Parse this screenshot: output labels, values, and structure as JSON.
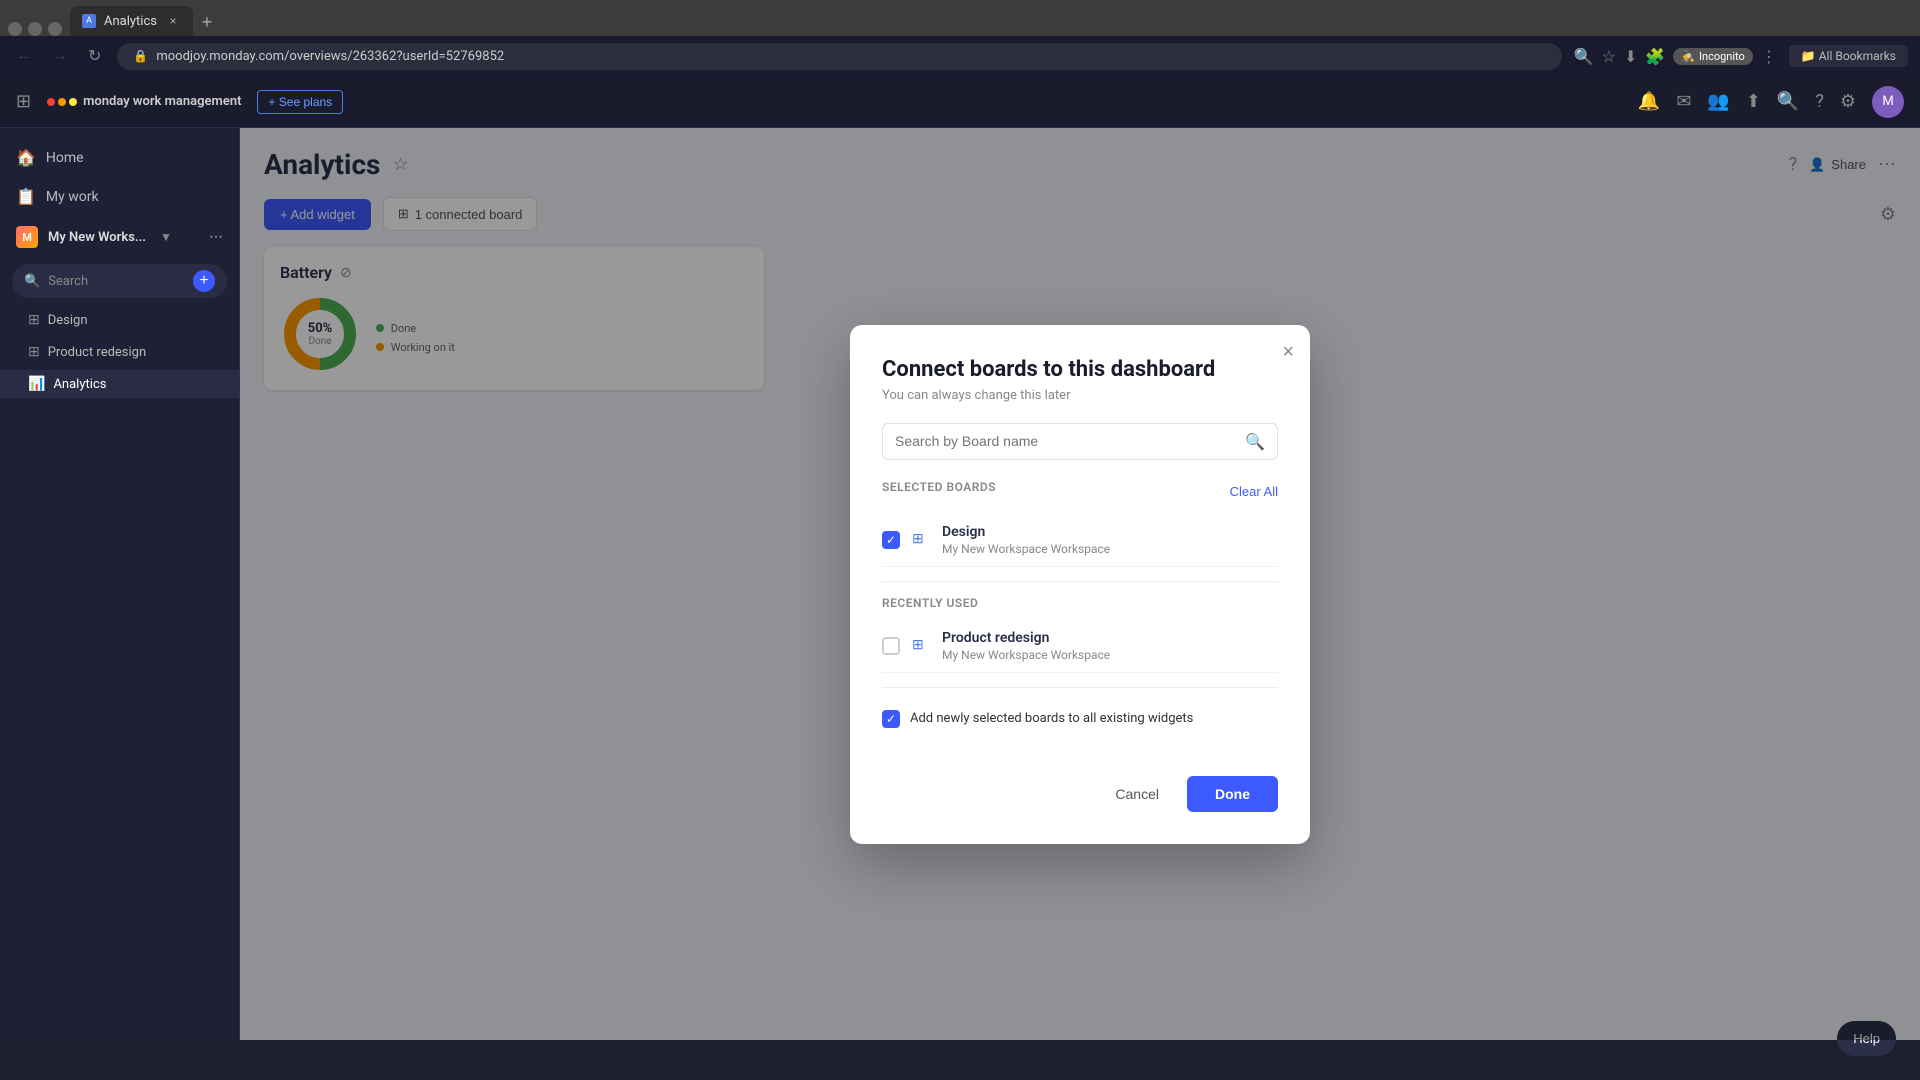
{
  "browser": {
    "tab_title": "Analytics",
    "tab_favicon": "A",
    "url": "moodjoy.monday.com/overviews/263362?userId=52769852",
    "incognito_label": "Incognito",
    "new_tab_icon": "+",
    "close_icon": "×",
    "back_icon": "←",
    "forward_icon": "→",
    "refresh_icon": "↻",
    "lock_icon": "🔒"
  },
  "app": {
    "logo_text": "monday work management",
    "see_plans_label": "+ See plans",
    "nav_icons": [
      "🔔",
      "✉",
      "👤",
      "⬆",
      "🔍",
      "?",
      "⚙"
    ]
  },
  "sidebar": {
    "home_label": "Home",
    "my_work_label": "My work",
    "workspace_name": "My New Works...",
    "search_placeholder": "Search",
    "add_button": "+",
    "boards": [
      {
        "name": "Design",
        "active": false
      },
      {
        "name": "Product redesign",
        "active": false
      },
      {
        "name": "Analytics",
        "active": true
      }
    ]
  },
  "main": {
    "page_title": "Analytics",
    "add_widget_label": "+ Add widget",
    "connect_boards_label": "1 connected board",
    "widget_title": "Battery",
    "stats_text": "50%\nDone",
    "legend": [
      {
        "color": "#4caf50",
        "label": "Done"
      },
      {
        "color": "#ff9800",
        "label": "Working on it"
      }
    ]
  },
  "modal": {
    "title": "Connect boards to this dashboard",
    "subtitle": "You can always change this later",
    "close_icon": "×",
    "search_placeholder": "Search by Board name",
    "search_icon": "🔍",
    "selected_boards_label": "Selected Boards",
    "clear_all_label": "Clear All",
    "selected_boards": [
      {
        "name": "Design",
        "workspace": "My New Workspace Workspace",
        "checked": true
      }
    ],
    "recently_used_label": "Recently Used",
    "recently_used_boards": [
      {
        "name": "Product redesign",
        "workspace": "My New Workspace Workspace",
        "checked": false
      }
    ],
    "add_boards_label": "Add newly selected boards to all existing widgets",
    "add_boards_checked": true,
    "cancel_label": "Cancel",
    "done_label": "Done"
  },
  "help": {
    "label": "Help"
  }
}
